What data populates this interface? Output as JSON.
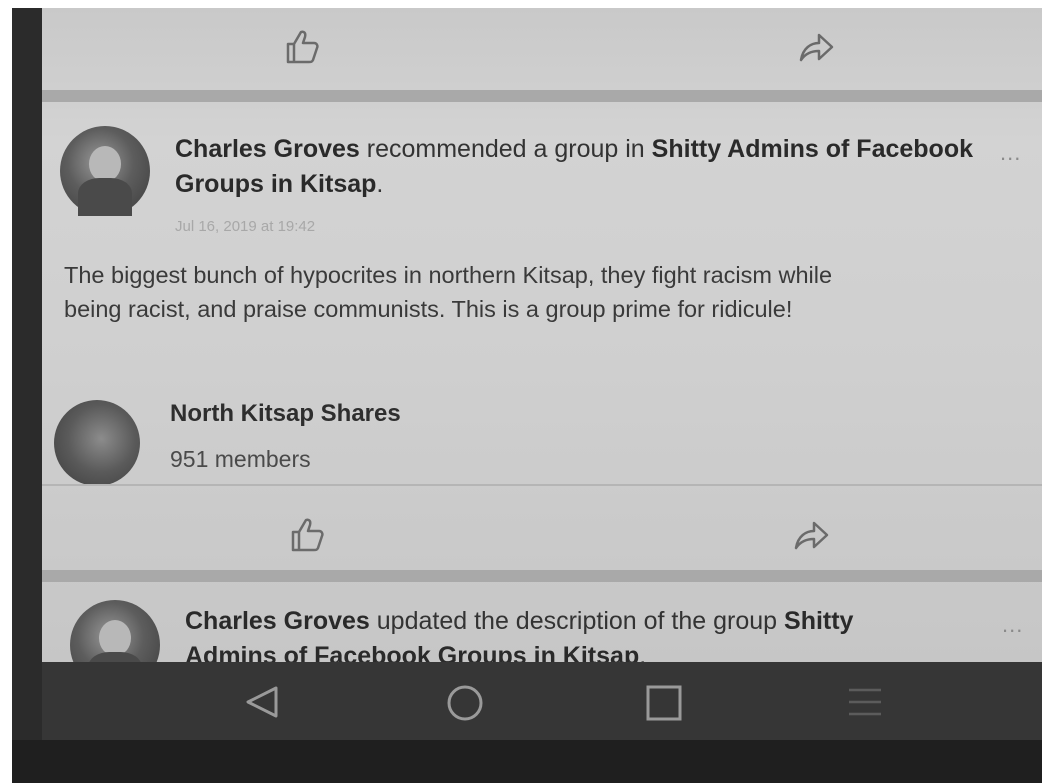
{
  "feed": {
    "post1": {
      "author": "Charles Groves",
      "action": " recommended a group in ",
      "group": "Shitty Admins of Facebook Groups in Kitsap",
      "period": ".",
      "timestamp": "Jul 16, 2019 at 19:42",
      "text_line1": "The biggest bunch of hypocrites in northern Kitsap, they fight racism while",
      "text_line2": "being racist, and praise communists. This is a group prime for ridicule!",
      "recommended_group": {
        "name": "North Kitsap Shares",
        "members": "951 members"
      },
      "more": "..."
    },
    "post2": {
      "author": "Charles Groves",
      "action": " updated the description of the group ",
      "group_line1": "Shitty",
      "group_line2": "Admins of Facebook Groups in Kitsap",
      "period": ".",
      "more": "..."
    }
  },
  "icons": {
    "like": "thumbs-up-icon",
    "share": "share-arrow-icon",
    "back": "back-triangle-icon",
    "home": "home-circle-icon",
    "recents": "recents-square-icon",
    "menu": "menu-lines-icon"
  },
  "colors": {
    "screen": "#cfcfcf",
    "divider": "#a9a9a9",
    "navbar": "#363636",
    "text": "#333333",
    "timestamp": "#a8a8a8"
  }
}
